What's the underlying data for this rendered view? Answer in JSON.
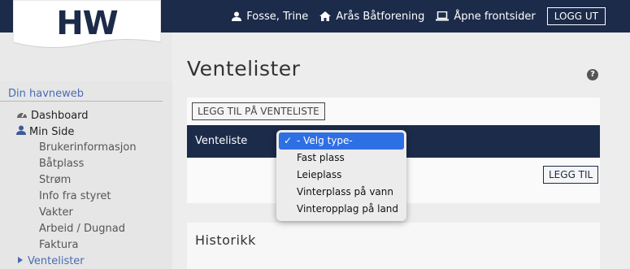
{
  "logo": {
    "text": "HW"
  },
  "topnav": {
    "user": "Fosse, Trine",
    "club": "Arås Båtforening",
    "public": "Åpne frontsider",
    "logout": "LOGG UT"
  },
  "sidebar": {
    "header": "Din havneweb",
    "dashboard": "Dashboard",
    "min_side": "Min Side",
    "items": [
      "Brukerinformasjon",
      "Båtplass",
      "Strøm",
      "Info fra styret",
      "Vakter",
      "Arbeid / Dugnad",
      "Faktura"
    ],
    "ventelister": "Ventelister"
  },
  "main": {
    "title": "Ventelister",
    "help": "?",
    "add_waitlist_button": "LEGG TIL PÅ VENTELISTE",
    "waitlist_label": "Venteliste",
    "add_button": "LEGG TIL",
    "history_title": "Historikk"
  },
  "dropdown": {
    "check": "✓",
    "options": [
      "- Velg type-",
      "Fast plass",
      "Leieplass",
      "Vinterplass på vann",
      "Vinteropplag på land"
    ]
  },
  "colors": {
    "navy": "#1c2b4a",
    "select_blue": "#2f6fe4",
    "link_blue": "#4a6bb2"
  }
}
